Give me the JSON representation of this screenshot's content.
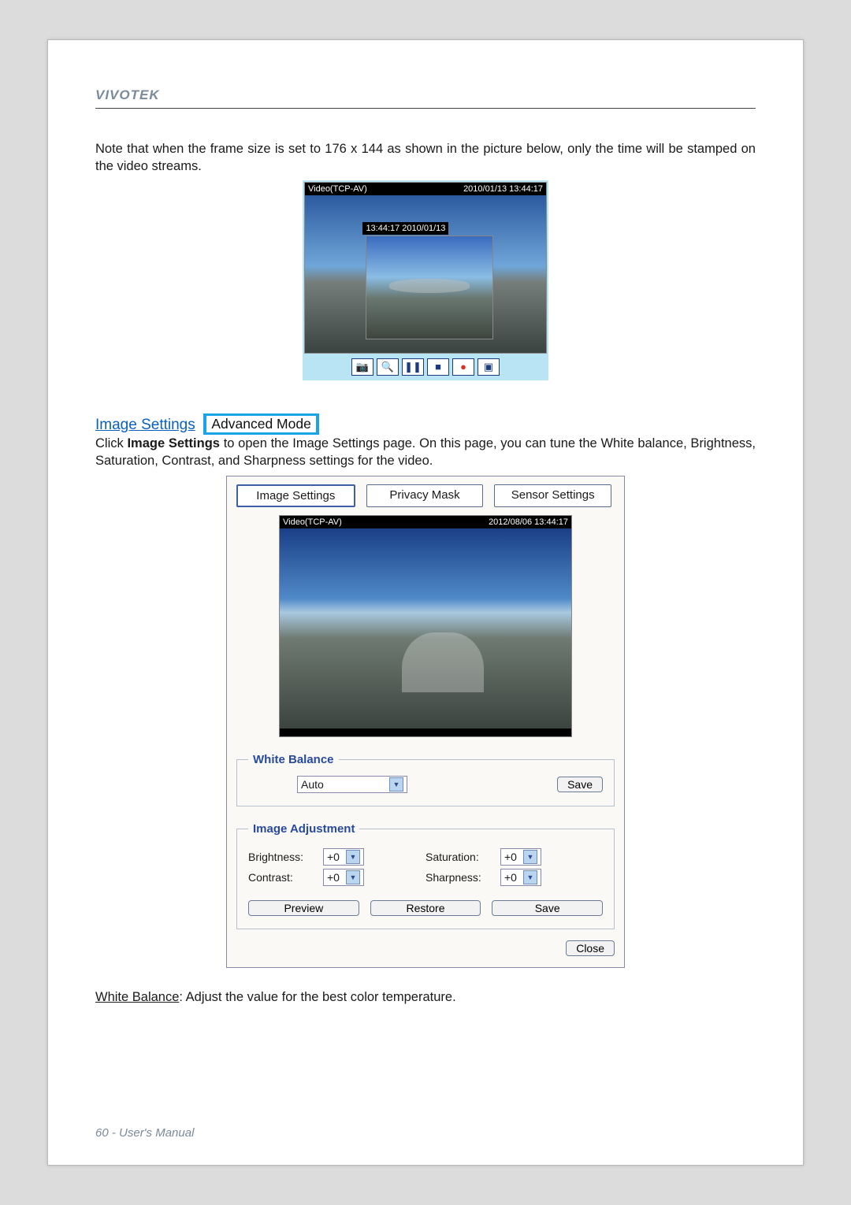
{
  "brand": "VIVOTEK",
  "paragraph1": "Note that when the frame size is set to 176 x 144 as shown in the picture below, only the time will be stamped on the video streams.",
  "viewer": {
    "caption_left": "Video(TCP-AV)",
    "caption_right": "2010/01/13 13:44:17",
    "overlay_timestamp": "13:44:17 2010/01/13",
    "toolbar_icons": {
      "snapshot": "camera-icon",
      "zoom": "zoom-icon",
      "pause": "pause-icon",
      "stop": "stop-icon",
      "record": "record-icon",
      "fullscreen": "fullscreen-icon"
    }
  },
  "section": {
    "link": "Image Settings",
    "badge": "Advanced Mode"
  },
  "paragraph2_pre": "Click ",
  "paragraph2_bold": "Image Settings",
  "paragraph2_post": " to open the Image Settings page. On this page, you can tune the White balance, Brightness, Saturation, Contrast, and Sharpness settings for the video.",
  "dialog": {
    "tabs": [
      "Image Settings",
      "Privacy Mask",
      "Sensor Settings"
    ],
    "active_tab_index": 0,
    "preview": {
      "caption_left": "Video(TCP-AV)",
      "caption_right": "2012/08/06 13:44:17"
    },
    "white_balance": {
      "legend": "White Balance",
      "value": "Auto",
      "save": "Save"
    },
    "image_adjustment": {
      "legend": "Image Adjustment",
      "brightness": {
        "label": "Brightness:",
        "value": "+0"
      },
      "contrast": {
        "label": "Contrast:",
        "value": "+0"
      },
      "saturation": {
        "label": "Saturation:",
        "value": "+0"
      },
      "sharpness": {
        "label": "Sharpness:",
        "value": "+0"
      },
      "preview": "Preview",
      "restore": "Restore",
      "save": "Save"
    },
    "close": "Close"
  },
  "wb_desc_label": "White Balance",
  "wb_desc_text": ": Adjust the value for the best color temperature.",
  "footer_page": "60 - User's Manual"
}
